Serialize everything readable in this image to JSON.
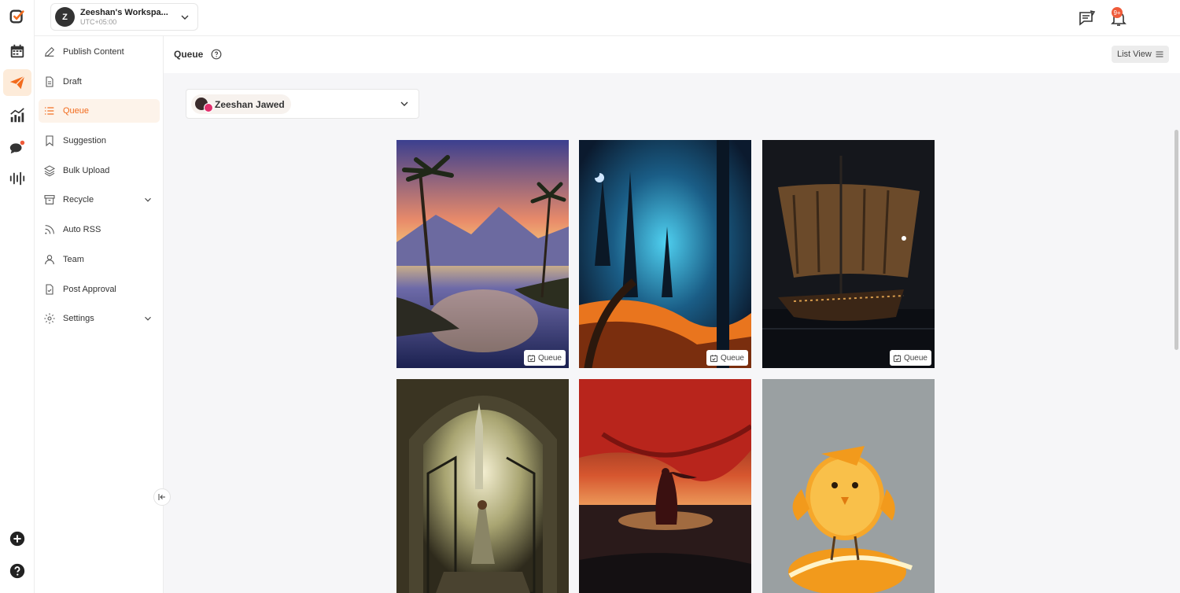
{
  "workspace": {
    "initial": "Z",
    "name": "Zeeshan's Workspa...",
    "timezone": "UTC+05:00"
  },
  "notifications": {
    "badge": "9+"
  },
  "sidebar": {
    "items": [
      {
        "label": "Publish Content"
      },
      {
        "label": "Draft"
      },
      {
        "label": "Queue"
      },
      {
        "label": "Suggestion"
      },
      {
        "label": "Bulk Upload"
      },
      {
        "label": "Recycle"
      },
      {
        "label": "Auto RSS"
      },
      {
        "label": "Team"
      },
      {
        "label": "Post Approval"
      },
      {
        "label": "Settings"
      }
    ]
  },
  "page": {
    "title": "Queue",
    "view_toggle": "List View"
  },
  "account": {
    "name": "Zeeshan Jawed"
  },
  "posts": [
    {
      "status": "Queue"
    },
    {
      "status": "Queue"
    },
    {
      "status": "Queue"
    }
  ],
  "colors": {
    "accent": "#f26b1d",
    "active_bg": "#fdf3ea",
    "badge": "#ef5b3a"
  }
}
